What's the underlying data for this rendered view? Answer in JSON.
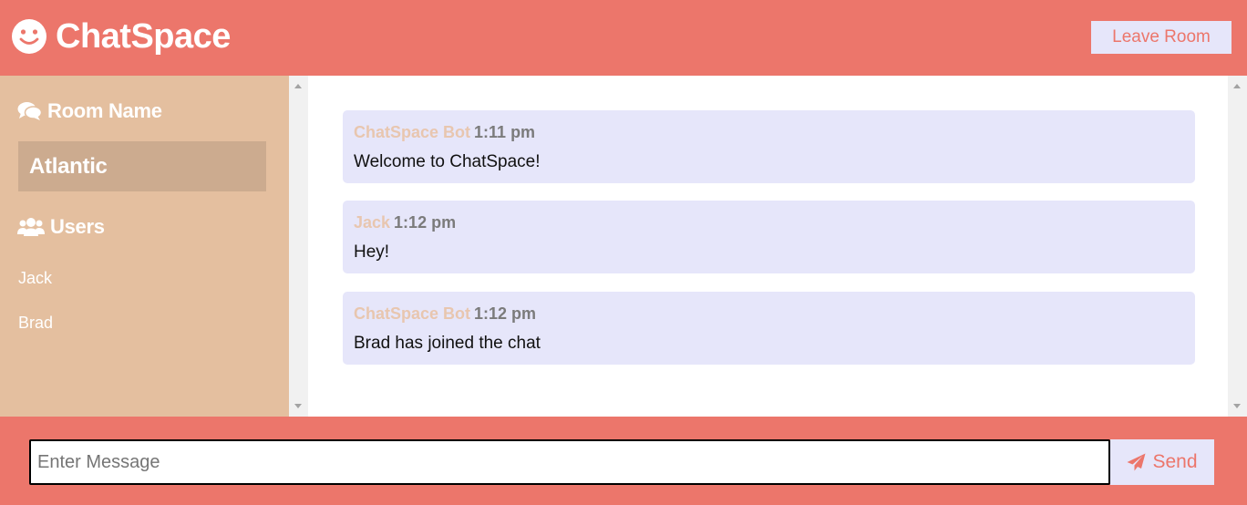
{
  "app": {
    "title": "ChatSpace",
    "logo_icon": "smile-icon",
    "leave_label": "Leave Room"
  },
  "sidebar": {
    "room_heading": "Room Name",
    "room_heading_icon": "comments-icon",
    "room_name": "Atlantic",
    "users_heading": "Users",
    "users_heading_icon": "users-icon",
    "users": [
      "Jack",
      "Brad"
    ]
  },
  "messages": [
    {
      "author": "ChatSpace Bot",
      "time": "1:11 pm",
      "text": "Welcome to ChatSpace!"
    },
    {
      "author": "Jack",
      "time": "1:12 pm",
      "text": "Hey!"
    },
    {
      "author": "ChatSpace Bot",
      "time": "1:12 pm",
      "text": "Brad has joined the chat"
    }
  ],
  "composer": {
    "placeholder": "Enter Message",
    "value": "",
    "send_label": "Send",
    "send_icon": "paper-plane-icon"
  },
  "colors": {
    "primary": "#ec766b",
    "sidebar": "#e4bf9f",
    "room_box": "#ccab8f",
    "message_bg": "#e6e6fa",
    "author": "#e8c6af"
  }
}
